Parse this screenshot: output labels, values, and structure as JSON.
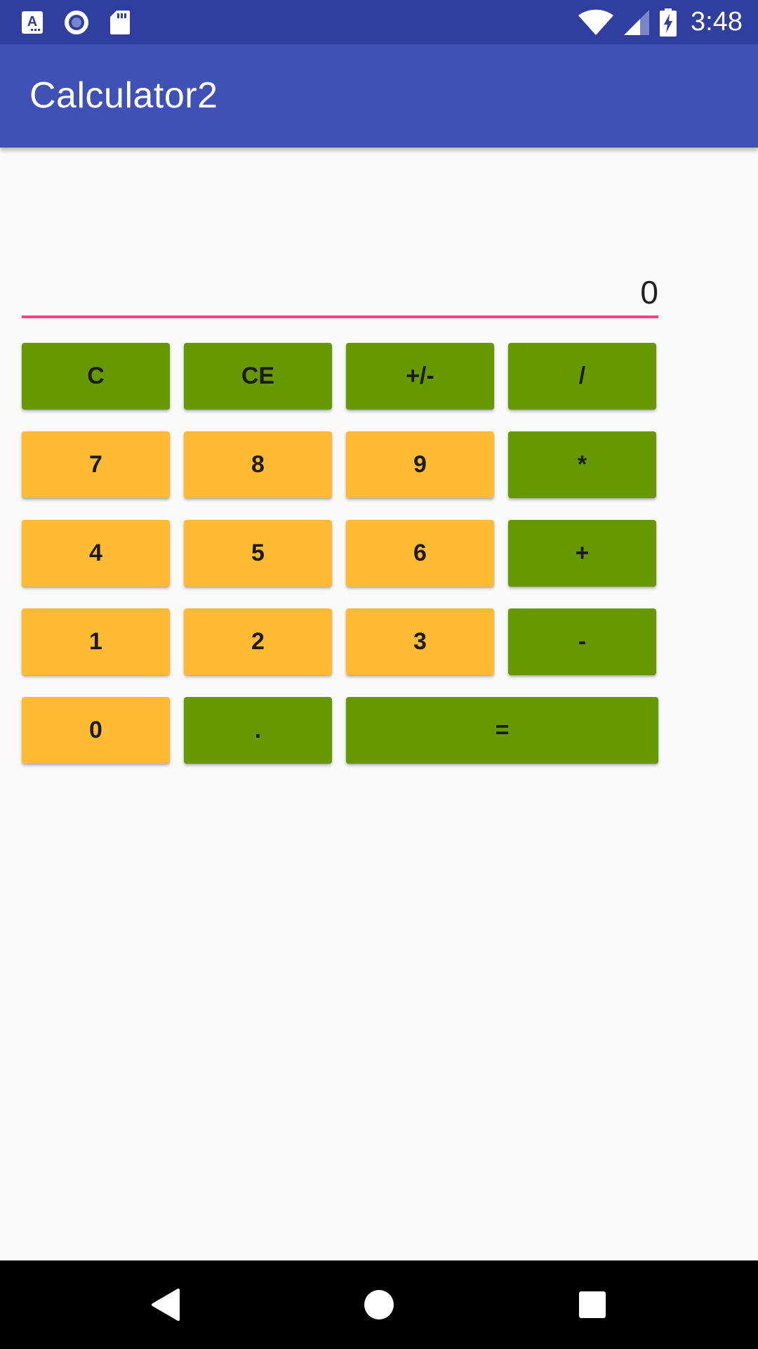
{
  "status_bar": {
    "time": "3:48",
    "left_icons": [
      "text-recognition-icon",
      "record-icon",
      "sd-card-icon"
    ],
    "right_icons": [
      "wifi-icon",
      "cellular-signal-icon",
      "battery-charging-icon"
    ]
  },
  "app_bar": {
    "title": "Calculator2"
  },
  "display": {
    "value": "0"
  },
  "keypad": {
    "rows": [
      [
        "C",
        "CE",
        "+/-",
        "/"
      ],
      [
        "7",
        "8",
        "9",
        "*"
      ],
      [
        "4",
        "5",
        "6",
        "+"
      ],
      [
        "1",
        "2",
        "3",
        "-"
      ],
      [
        "0",
        ".",
        "="
      ]
    ]
  },
  "nav_bar": {
    "icons": [
      "back-icon",
      "home-icon",
      "recent-apps-icon"
    ]
  },
  "colors": {
    "status_bar": "#303f9f",
    "app_bar": "#3f51b5",
    "operator_key": "#669900",
    "number_key": "#ffbb33",
    "accent_underline": "#ff4081",
    "background": "#fafafa"
  }
}
